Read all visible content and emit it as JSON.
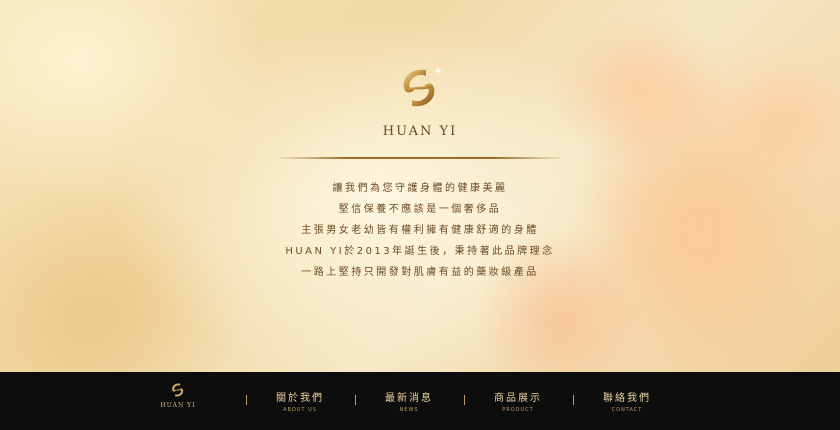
{
  "brand": {
    "name": "HUAN YI"
  },
  "tagline": [
    "讓我們為您守護身體的健康美麗",
    "堅信保養不應該是一個奢侈品",
    "主張男女老幼皆有權利擁有健康舒適的身體",
    "HUAN YI於2013年誕生後，秉持著此品牌理念",
    "一路上堅持只開發對肌膚有益的藥妝級產品"
  ],
  "footer": {
    "brand": "HUAN YI",
    "nav": [
      {
        "zh": "關於我們",
        "en": "ABOUT US"
      },
      {
        "zh": "最新消息",
        "en": "NEWS"
      },
      {
        "zh": "商品展示",
        "en": "PRODUCT"
      },
      {
        "zh": "聯絡我們",
        "en": "CONTACT"
      }
    ]
  },
  "colors": {
    "gold": "#c9a050",
    "footer_bg": "#0d0d0d",
    "text": "#6b4a22"
  }
}
